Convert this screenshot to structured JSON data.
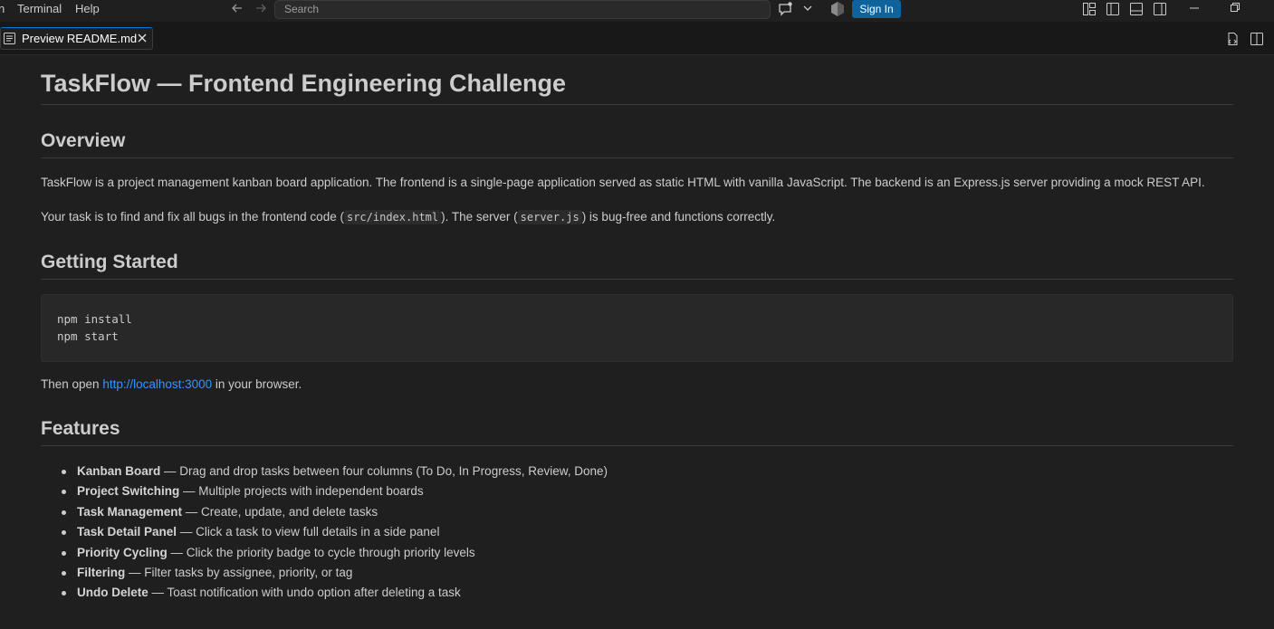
{
  "menu": {
    "terminal": "Terminal",
    "help": "Help"
  },
  "search": {
    "placeholder": "Search"
  },
  "titlebar": {
    "sign_in": "Sign In",
    "accent": "#0e639c"
  },
  "tab": {
    "label": "Preview README.md"
  },
  "doc": {
    "h1": "TaskFlow — Frontend Engineering Challenge",
    "overview": {
      "heading": "Overview",
      "p1": "TaskFlow is a project management kanban board application. The frontend is a single-page application served as static HTML with vanilla JavaScript. The backend is an Express.js server providing a mock REST API.",
      "p2_before": "Your task is to find and fix all bugs in the frontend code (",
      "p2_code1": "src/index.html",
      "p2_mid": "). The server (",
      "p2_code2": "server.js",
      "p2_after": ") is bug-free and functions correctly."
    },
    "getting_started": {
      "heading": "Getting Started",
      "code_lines": [
        "npm install",
        "npm start"
      ],
      "open_before": "Then open ",
      "open_link": "http://localhost:3000",
      "open_after": " in your browser."
    },
    "features": {
      "heading": "Features",
      "items": [
        {
          "name": "Kanban Board",
          "desc": " — Drag and drop tasks between four columns (To Do, In Progress, Review, Done)"
        },
        {
          "name": "Project Switching",
          "desc": " — Multiple projects with independent boards"
        },
        {
          "name": "Task Management",
          "desc": " — Create, update, and delete tasks"
        },
        {
          "name": "Task Detail Panel",
          "desc": " — Click a task to view full details in a side panel"
        },
        {
          "name": "Priority Cycling",
          "desc": " — Click the priority badge to cycle through priority levels"
        },
        {
          "name": "Filtering",
          "desc": " — Filter tasks by assignee, priority, or tag"
        },
        {
          "name": "Undo Delete",
          "desc": " — Toast notification with undo option after deleting a task"
        }
      ]
    }
  },
  "icons": {
    "back": "arrow-left-icon",
    "forward": "arrow-right-icon",
    "chat": "chat-icon",
    "account": "accounts-icon",
    "layout": "customize-layout-icon",
    "toggle_sidebar": "toggle-primary-sidebar-icon",
    "toggle_panel": "toggle-panel-icon",
    "toggle_secondary": "toggle-secondary-sidebar-icon",
    "preview": "preview-icon",
    "open_source": "open-source-icon",
    "split": "split-editor-icon",
    "close": "close-icon"
  }
}
